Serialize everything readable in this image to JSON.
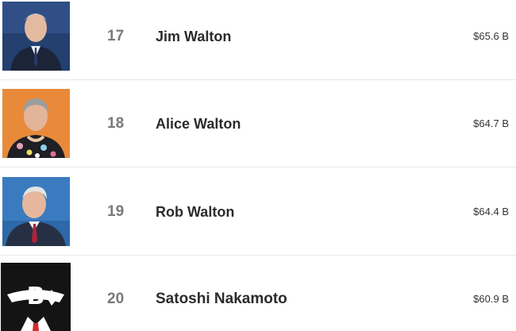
{
  "colors": {
    "rank_text": "#7a7a7a",
    "name_text": "#2b2b2b",
    "worth_text": "#333333",
    "divider": "#e8e8e8"
  },
  "billionaires": [
    {
      "rank": "17",
      "name": "Jim Walton",
      "net_worth": "$65.6 B",
      "photo": "portrait-photo"
    },
    {
      "rank": "18",
      "name": "Alice Walton",
      "net_worth": "$64.7 B",
      "photo": "portrait-photo"
    },
    {
      "rank": "19",
      "name": "Rob Walton",
      "net_worth": "$64.4 B",
      "photo": "portrait-photo"
    },
    {
      "rank": "20",
      "name": "Satoshi Nakamoto",
      "net_worth": "$60.9 B",
      "photo": "anonymous-bitcoin-avatar"
    }
  ]
}
